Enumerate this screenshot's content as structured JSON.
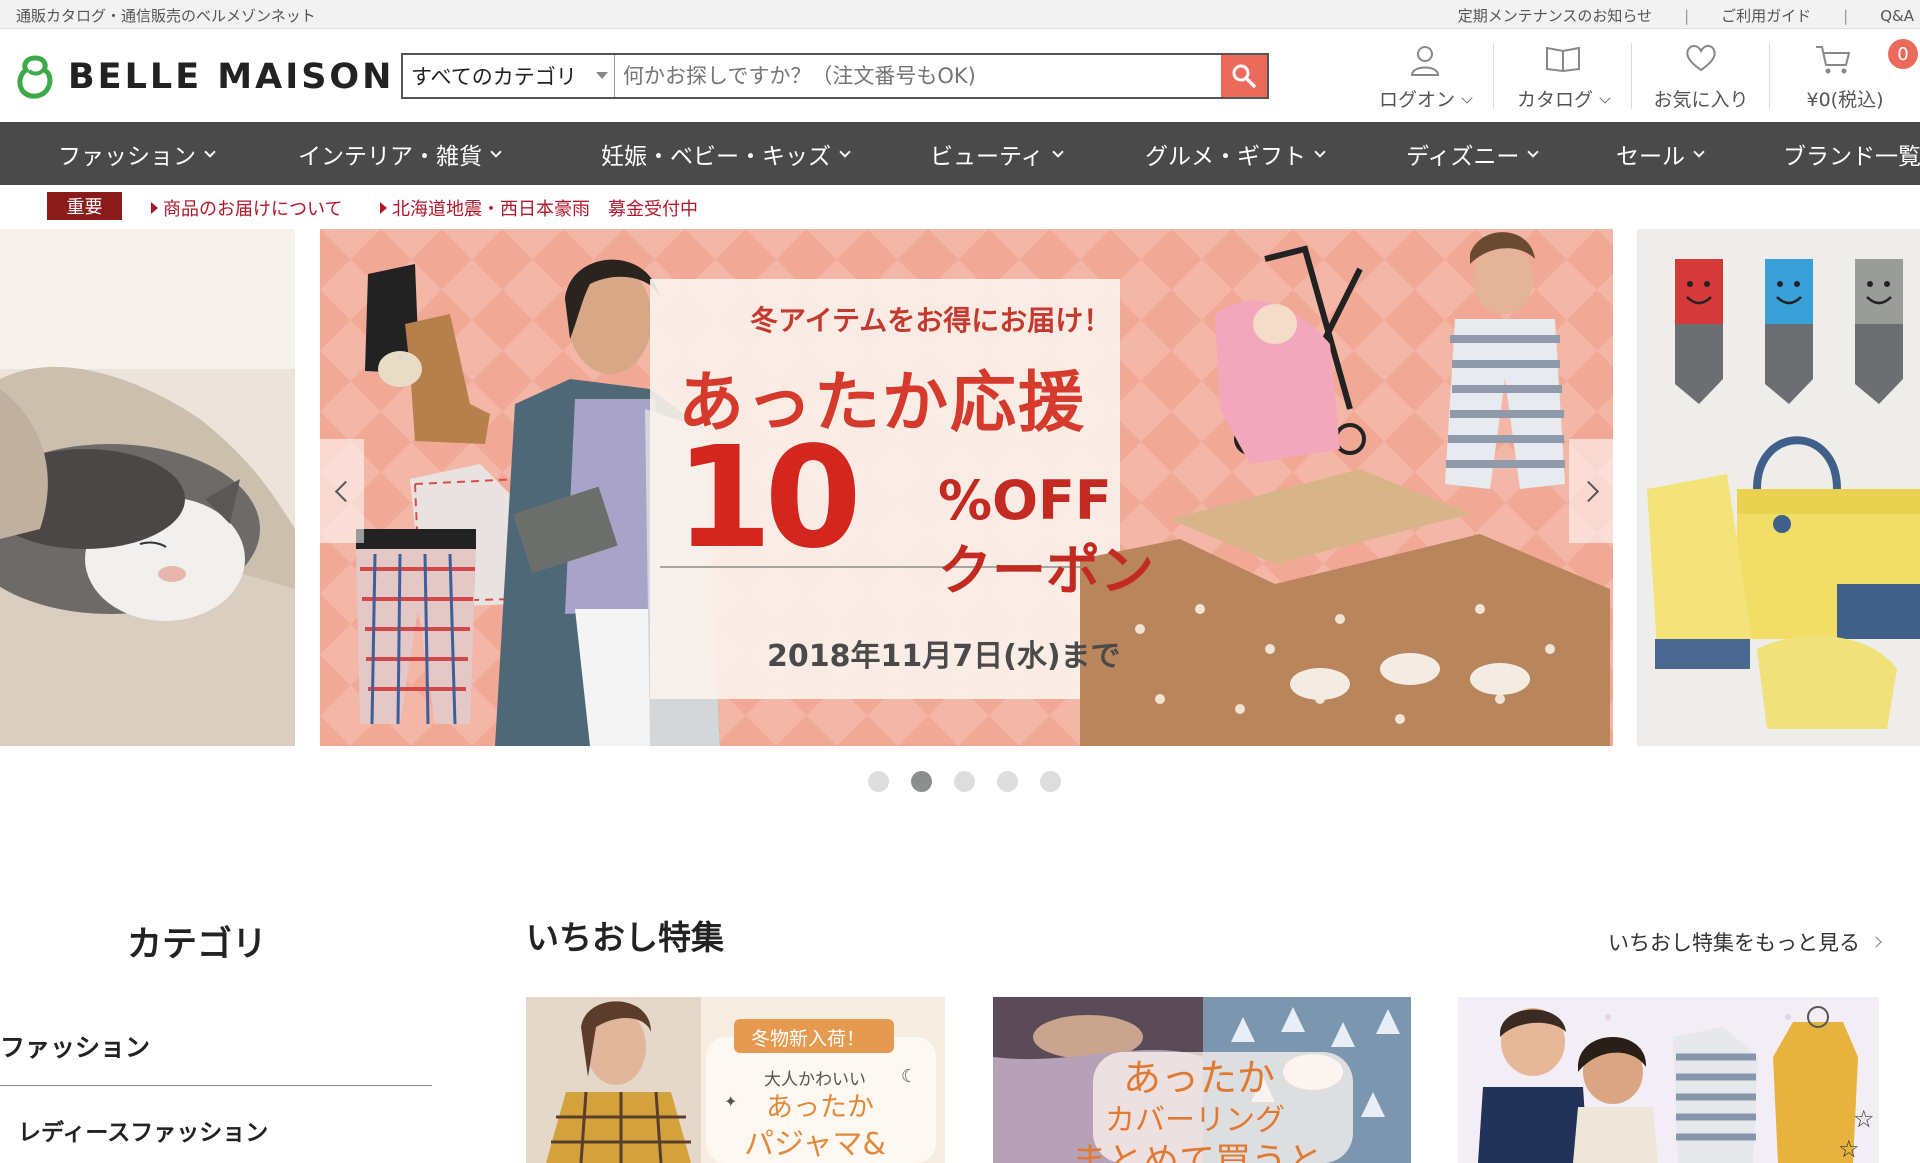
{
  "topbar": {
    "tagline": "通販カタログ・通信販売のベルメゾンネット",
    "links": [
      "定期メンテナンスのお知らせ",
      "ご利用ガイド",
      "Q&A"
    ]
  },
  "header": {
    "logo_text": "BELLE MAISON",
    "search": {
      "category": "すべてのカテゴリ",
      "placeholder": "何かお探しですか？（注文番号もOK)"
    },
    "icons": {
      "login": "ログオン",
      "catalog": "カタログ",
      "favorites": "お気に入り",
      "cart_total": "¥0(税込)",
      "cart_count": "0"
    }
  },
  "nav": {
    "items": [
      "ファッション",
      "インテリア・雑貨",
      "妊娠・ベビー・キッズ",
      "ビューティ",
      "グルメ・ギフト",
      "ディズニー",
      "セール",
      "ブランド一覧"
    ]
  },
  "notice": {
    "badge": "重要",
    "items": [
      "商品のお届けについて",
      "北海道地震・西日本豪雨　募金受付中"
    ]
  },
  "banner": {
    "subtitle": "冬アイテムをお得にお届け！",
    "headline": "あったか応援",
    "discount_number": "10",
    "discount_unit": "%OFF",
    "discount_word": "クーポン",
    "deadline": "2018年11月7日(水)まで"
  },
  "carousel": {
    "slide_count": 5,
    "active_index": 1
  },
  "category": {
    "title": "カテゴリ",
    "items": [
      "ファッション",
      "レディースファッション"
    ]
  },
  "featured": {
    "title": "いちおし特集",
    "more": "いちおし特集をもっと見る",
    "card1": {
      "tag": "冬物新入荷！",
      "line1": "大人かわいい",
      "line2": "あったか",
      "line3": "パジャマ&"
    },
    "card2": {
      "line1": "あったか",
      "line2": "カバーリング",
      "line3": "まとめて買うと"
    }
  },
  "colors": {
    "accent": "#ec6a5c",
    "nav_bg": "#4a4a4a",
    "notice_red": "#b0172b",
    "badge_red": "#8b1a1a",
    "brand_green": "#3daa4a"
  }
}
